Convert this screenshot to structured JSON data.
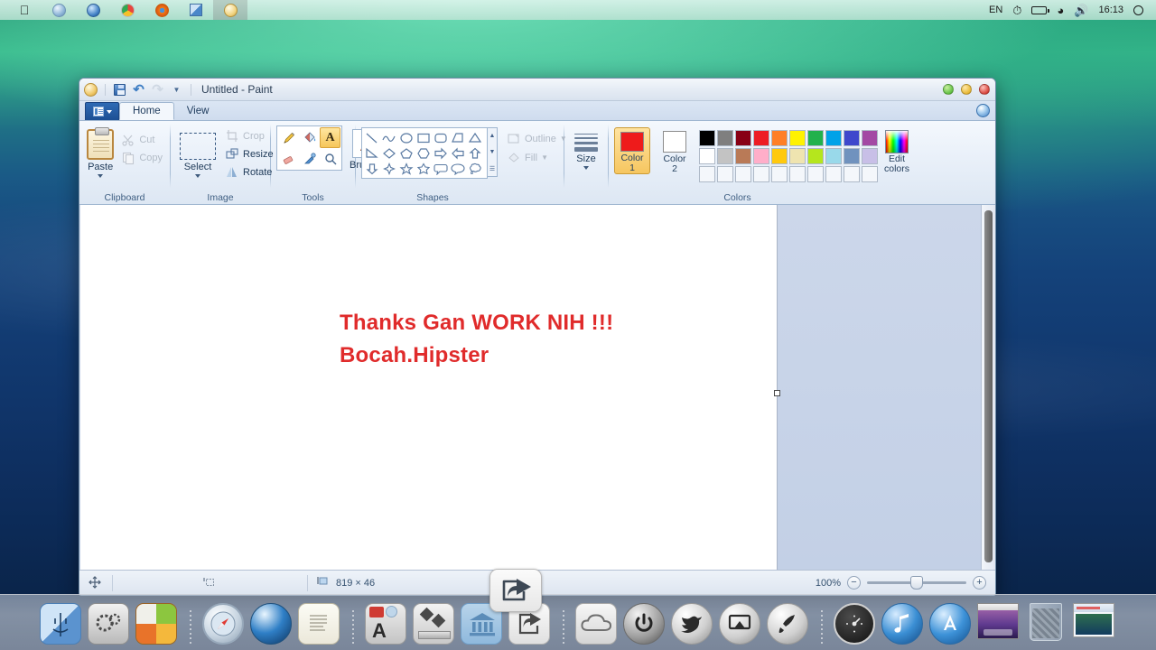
{
  "menubar": {
    "left_icons": [
      "apple-logo",
      "safari-icon",
      "spotlight-globe-icon",
      "chrome-icon",
      "firefox-icon",
      "finder-blue-icon",
      "paint-orb-icon"
    ],
    "input_source": "EN",
    "right_icons": [
      "time-machine-icon",
      "battery-icon",
      "wifi-icon",
      "volume-icon"
    ],
    "clock": "16:13",
    "notification_center_icon": "notification-center-icon"
  },
  "window": {
    "title": "Untitled - Paint",
    "quick_access": {
      "paint_orb": "paint-orb-icon",
      "save": "save-icon",
      "undo": "undo-icon",
      "redo": "redo-icon",
      "customize": "chevron-down-icon"
    },
    "controls": {
      "close": "green",
      "minimize": "yellow",
      "zoom": "red"
    },
    "help_label": "?"
  },
  "tabs": {
    "menu_button": "file-menu-button",
    "items": [
      {
        "label": "Home",
        "active": true
      },
      {
        "label": "View",
        "active": false
      }
    ]
  },
  "ribbon": {
    "groups": [
      {
        "name": "Clipboard",
        "label": "Clipboard",
        "big_button": {
          "label": "Paste",
          "icon": "clipboard-icon"
        },
        "small_buttons": [
          {
            "label": "Cut",
            "icon": "scissors-icon",
            "enabled": false
          },
          {
            "label": "Copy",
            "icon": "copy-icon",
            "enabled": false
          }
        ]
      },
      {
        "name": "Image",
        "label": "Image",
        "big_button": {
          "label": "Select",
          "icon": "selection-rect-icon"
        },
        "small_buttons": [
          {
            "label": "Crop",
            "icon": "crop-icon",
            "enabled": false
          },
          {
            "label": "Resize",
            "icon": "resize-icon",
            "enabled": true
          },
          {
            "label": "Rotate",
            "icon": "rotate-icon",
            "enabled": true
          }
        ]
      },
      {
        "name": "Tools",
        "label": "Tools",
        "tools": [
          {
            "name": "pencil-tool",
            "selected": false
          },
          {
            "name": "fill-tool",
            "selected": false
          },
          {
            "name": "text-tool",
            "selected": true
          },
          {
            "name": "eraser-tool",
            "selected": false
          },
          {
            "name": "color-picker-tool",
            "selected": false
          },
          {
            "name": "magnifier-tool",
            "selected": false
          }
        ],
        "brushes": {
          "label": "Brushes",
          "icon": "paintbrush-icon"
        }
      },
      {
        "name": "Shapes",
        "label": "Shapes",
        "shapes": [
          "line",
          "curve",
          "oval",
          "rectangle",
          "rounded-rectangle",
          "polygon",
          "triangle",
          "right-triangle",
          "diamond",
          "pentagon",
          "hexagon",
          "right-arrow",
          "left-arrow",
          "up-arrow",
          "down-arrow",
          "four-point-star",
          "five-point-star",
          "six-point-star",
          "rounded-callout",
          "oval-callout",
          "cloud-callout"
        ],
        "outline": {
          "label": "Outline",
          "enabled": false
        },
        "fill": {
          "label": "Fill",
          "enabled": false
        }
      },
      {
        "name": "Size",
        "label": "",
        "size_button": {
          "label": "Size",
          "icon": "line-thickness-icon"
        }
      },
      {
        "name": "Colors",
        "label": "Colors",
        "color1": {
          "label_line1": "Color",
          "label_line2": "1",
          "value": "#ee1b1b",
          "active": true
        },
        "color2": {
          "label_line1": "Color",
          "label_line2": "2",
          "value": "#ffffff",
          "active": false
        },
        "palette_row1": [
          "#000000",
          "#7f7f7f",
          "#880015",
          "#ed1c24",
          "#ff7f27",
          "#fff200",
          "#22b14c",
          "#00a2e8",
          "#3f48cc",
          "#a349a4"
        ],
        "palette_row2": [
          "#ffffff",
          "#c3c3c3",
          "#b97a57",
          "#ffaec9",
          "#ffc90e",
          "#efe4b0",
          "#b5e61d",
          "#99d9ea",
          "#7092be",
          "#c8bfe7"
        ],
        "palette_row3": [
          "",
          "",
          "",
          "",
          "",
          "",
          "",
          "",
          "",
          ""
        ],
        "edit_colors": {
          "label_line1": "Edit",
          "label_line2": "colors",
          "icon": "color-spectrum-icon"
        }
      }
    ]
  },
  "canvas": {
    "text_line1": "Thanks Gan WORK NIH !!!",
    "text_line2": "Bocah.Hipster",
    "text_color": "#e02b2b",
    "background": "#ffffff"
  },
  "statusbar": {
    "cursor_icon": "crosshair-position-icon",
    "selection_icon": "selection-size-icon",
    "image_size_icon": "image-size-icon",
    "image_size": "819 × 46",
    "zoom_level": "100%",
    "zoom_out_label": "−",
    "zoom_in_label": "+"
  },
  "overlay": {
    "share_icon": "share-icon"
  },
  "dock": {
    "items": [
      {
        "name": "finder",
        "icon": "finder-icon"
      },
      {
        "name": "system-preferences",
        "icon": "gears-icon"
      },
      {
        "name": "ilife-suite",
        "icon": "ilife-icon"
      },
      {
        "name": "safari",
        "icon": "compass-icon"
      },
      {
        "name": "spotlight-sphere",
        "icon": "blue-sphere-icon"
      },
      {
        "name": "stickies-notes",
        "icon": "notes-icon"
      },
      {
        "name": "app-store-folder",
        "icon": "applications-folder-icon"
      },
      {
        "name": "utilities-folder",
        "icon": "utilities-folder-icon"
      },
      {
        "name": "bank-app",
        "icon": "bank-columns-icon"
      },
      {
        "name": "share-app",
        "icon": "share-square-icon"
      },
      {
        "name": "cloud-app",
        "icon": "cloud-icon"
      },
      {
        "name": "power-app",
        "icon": "power-icon"
      },
      {
        "name": "twitter-app",
        "icon": "bird-icon"
      },
      {
        "name": "airplay-app",
        "icon": "airplay-icon"
      },
      {
        "name": "launcher-app",
        "icon": "rocket-icon"
      },
      {
        "name": "dashboard",
        "icon": "gauge-icon"
      },
      {
        "name": "itunes",
        "icon": "music-note-icon"
      },
      {
        "name": "app-store",
        "icon": "app-store-a-icon"
      },
      {
        "name": "desktop-window",
        "icon": "desktop-thumbnail-icon"
      },
      {
        "name": "trash",
        "icon": "trash-icon"
      },
      {
        "name": "document-window",
        "icon": "document-thumbnail-icon"
      }
    ]
  }
}
